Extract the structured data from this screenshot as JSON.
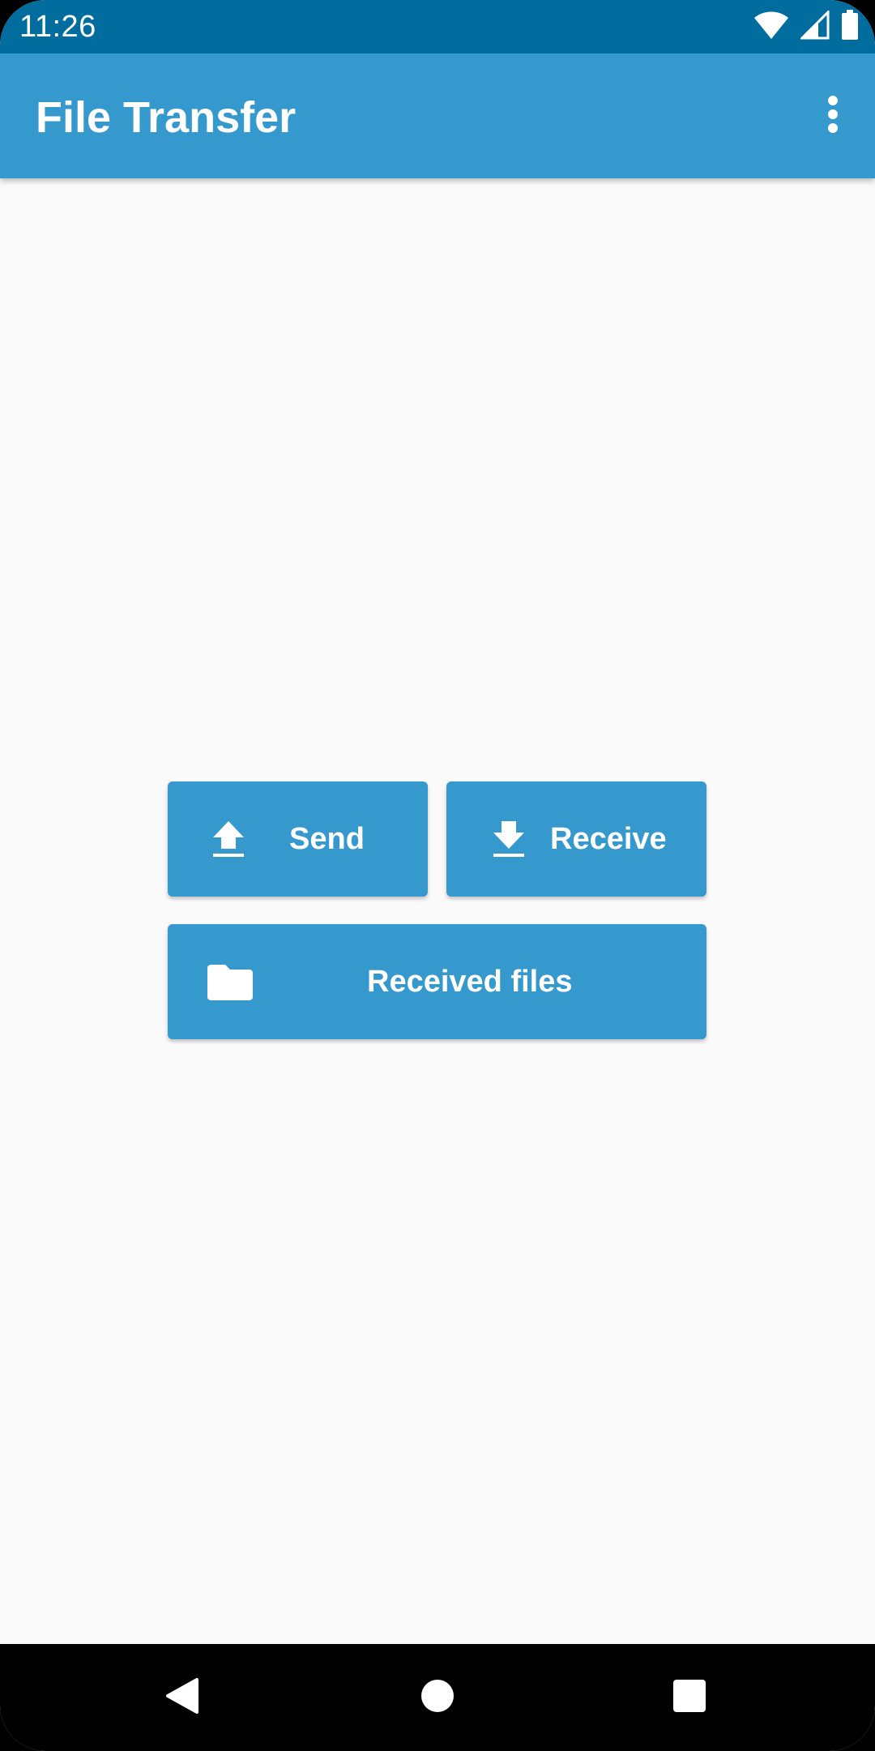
{
  "status_bar": {
    "time": "11:26",
    "icons": [
      "wifi-icon",
      "cell-signal-icon",
      "battery-icon"
    ],
    "color": "#006d9e"
  },
  "app_bar": {
    "title": "File Transfer",
    "overflow_icon": "more-vert-icon",
    "color": "#3599cd"
  },
  "actions": {
    "send": {
      "label": "Send",
      "icon": "upload-icon"
    },
    "receive": {
      "label": "Receive",
      "icon": "download-icon"
    },
    "received_files": {
      "label": "Received files",
      "icon": "folder-icon"
    },
    "button_color": "#3599cd"
  },
  "nav_bar": {
    "buttons": [
      "back-icon",
      "home-icon",
      "recents-icon"
    ]
  },
  "colors": {
    "background": "#fafafa",
    "on_primary": "#ffffff"
  }
}
